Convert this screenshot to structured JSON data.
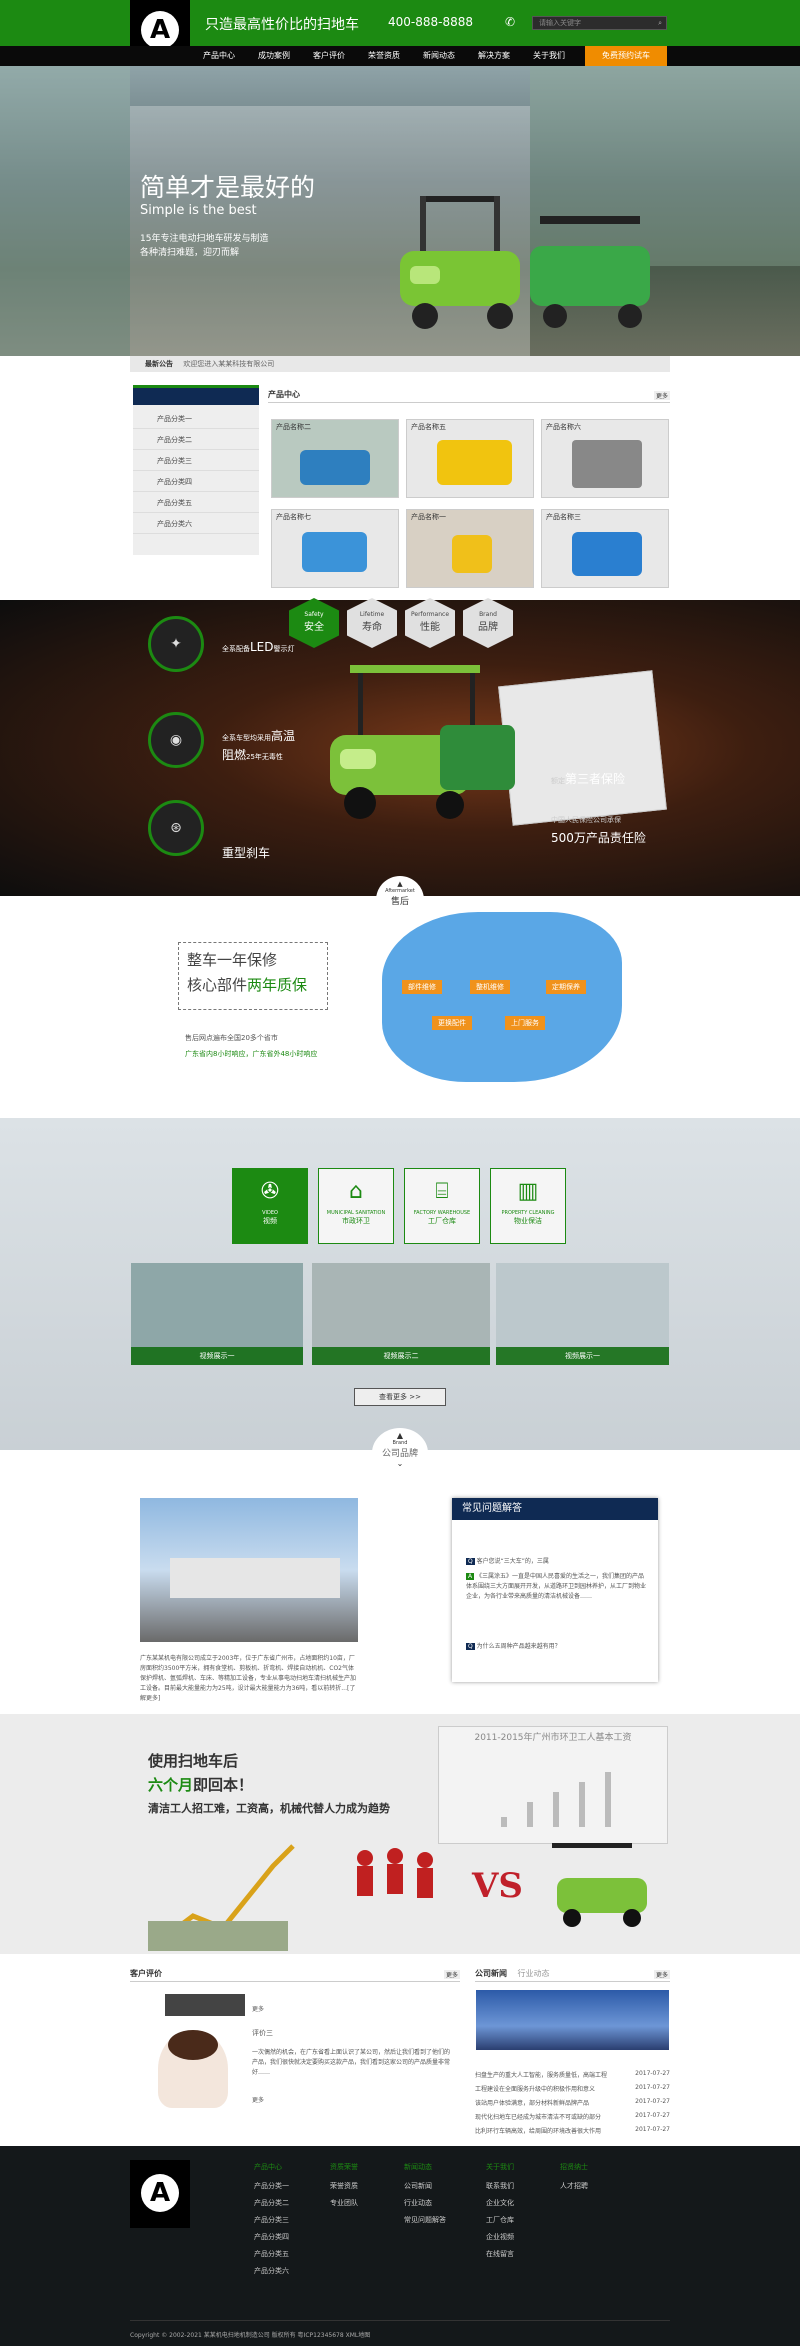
{
  "header": {
    "logo_letter": "A",
    "slogan": "只造最高性价比的扫地车",
    "phone": "400-888-8888",
    "wechat_icon": "wechat-icon",
    "search_placeholder": "请输入关键字"
  },
  "nav": {
    "items": [
      "产品中心",
      "成功案例",
      "客户评价",
      "荣誉资质",
      "新闻动态",
      "解决方案",
      "关于我们"
    ],
    "cta": "免费预约试车"
  },
  "hero": {
    "title": "简单才是最好的",
    "subtitle": "Simple is the best",
    "line1": "15年专注电动扫地车研发与制造",
    "line2": "各种清扫难题，迎刃而解"
  },
  "notice": {
    "label": "最新公告",
    "text": "欢迎您进入某某科技有限公司"
  },
  "sidebar": {
    "items": [
      "产品分类一",
      "产品分类二",
      "产品分类三",
      "产品分类四",
      "产品分类五",
      "产品分类六"
    ]
  },
  "products": {
    "title": "产品中心",
    "more": "更多",
    "items": [
      "产品名称二",
      "产品名称五",
      "产品名称六",
      "产品名称七",
      "产品名称一",
      "产品名称三"
    ]
  },
  "features": {
    "tabs": [
      {
        "en": "Safety",
        "cn": "安全"
      },
      {
        "en": "Lifetime",
        "cn": "寿命"
      },
      {
        "en": "Performance",
        "cn": "性能"
      },
      {
        "en": "Brand",
        "cn": "品牌"
      }
    ],
    "led_a": "全系配备",
    "led_b": "LED",
    "led_c": "警示灯",
    "tire_a": "全系车型均采用",
    "tire_b": "高温",
    "tire_c": "阻燃",
    "tire_d": "25年无毒性",
    "brake": "重型刹车",
    "ins_a": "额定",
    "ins_b": "第三者保险",
    "ins_c": "中国人民保险公司承保",
    "ins_d": "500万产品责任险"
  },
  "after": {
    "en": "Aftermarket",
    "cn": "售后",
    "p1": "整车一年保修",
    "p2a": "核心部件",
    "p2b": "两年质保",
    "l1": "售后网点遍布全国20多个省市",
    "l2": "广东省内8小时响应，广东省外48小时响应",
    "tags": [
      "部件维修",
      "整机维修",
      "定期保养",
      "更换配件",
      "上门服务"
    ]
  },
  "cases": {
    "boxes": [
      {
        "en": "VIDEO",
        "cn": "视频",
        "icon": "film-icon"
      },
      {
        "en": "MUNICIPAL SANITATION",
        "cn": "市政环卫",
        "icon": "building-icon"
      },
      {
        "en": "FACTORY WAREHOUSE",
        "cn": "工厂仓库",
        "icon": "factory-icon"
      },
      {
        "en": "PROPERTY CLEANING",
        "cn": "物业保洁",
        "icon": "property-icon"
      }
    ],
    "shots": [
      "视频展示一",
      "视频展示二",
      "视频展示一"
    ],
    "more": "查看更多 >>"
  },
  "brand": {
    "en": "Brand",
    "cn": "公司品牌",
    "desc": "广东某某机电有限公司成立于2003年，位于广东省广州市，占地面积约10亩，厂房面积约3500平方米，拥有食堂机、剪板机、折弯机、焊接自动机机、CO2气体保护焊机、氩弧焊机、车床、等精加工设备，专业从事电动扫地车清扫机械生产加工设备。目前最大能量能力为25吨，设计最大能量能力为36吨，看以前转折...[了解更多]",
    "faq_title": "常见问题解答",
    "faq_q1": "客户您说“三大车”的，三属",
    "faq_a1": "《三属涂五》一直是中国人民喜爱的生活之一，我们集团的产品体系围绕三大方面展开开发，从道路环卫到园林养护，从工厂到物业企业，为各行业带来高质量的清洁机械设备……",
    "faq_q2": "为什么五周种产品越来越有用？"
  },
  "roi": {
    "l1a": "使用",
    "l1b": "扫地车",
    "l1c": "后",
    "l2a": "六个月",
    "l2b": "即回本！",
    "l3": "清洁工人招工难，工资高，机械代替人力成为趋势",
    "chart_title": "2011-2015年广州市环卫工人基本工资",
    "vs": "VS"
  },
  "reviews": {
    "title": "客户评价",
    "more": "更多",
    "name": "评价三",
    "text": "一次偶然的机会，在广东省看上面认识了某公司，然后让我们看到了他们的产品，我们很快就决定要购买这款产品，我们看到这家公司的产品质量非常好……",
    "more2": "更多"
  },
  "news": {
    "tab1": "公司新闻",
    "tab2": "行业动态",
    "more": "更多",
    "items": [
      {
        "t": "扫盘生产的重大人工智能，服务质量低，高端工程",
        "d": "2017-07-27"
      },
      {
        "t": "工程建设在全面服务升级中的积极作用和意义",
        "d": "2017-07-27"
      },
      {
        "t": "该站用户体验满意，部分材料新鲜品牌产品",
        "d": "2017-07-27"
      },
      {
        "t": "现代化扫地车已经成为城市清洁不可或缺的部分",
        "d": "2017-07-27"
      },
      {
        "t": "比利环行车辆高效，给周围的环境改善很大作用",
        "d": "2017-07-27"
      }
    ]
  },
  "footer": {
    "cols": [
      {
        "h": "产品中心",
        "i": [
          "产品分类一",
          "产品分类二",
          "产品分类三",
          "产品分类四",
          "产品分类五",
          "产品分类六"
        ]
      },
      {
        "h": "资质荣誉",
        "i": [
          "荣誉资质",
          "专业团队"
        ]
      },
      {
        "h": "新闻动态",
        "i": [
          "公司新闻",
          "行业动态",
          "常见问题解答"
        ]
      },
      {
        "h": "关于我们",
        "i": [
          "联系我们",
          "企业文化",
          "工厂仓库",
          "企业视频",
          "在线留言"
        ]
      },
      {
        "h": "招贤纳士",
        "i": [
          "人才招聘"
        ]
      }
    ],
    "copyright": "Copyright © 2002-2021 某某机电扫地机制造公司 版权所有  粤ICP12345678  XML地图"
  }
}
